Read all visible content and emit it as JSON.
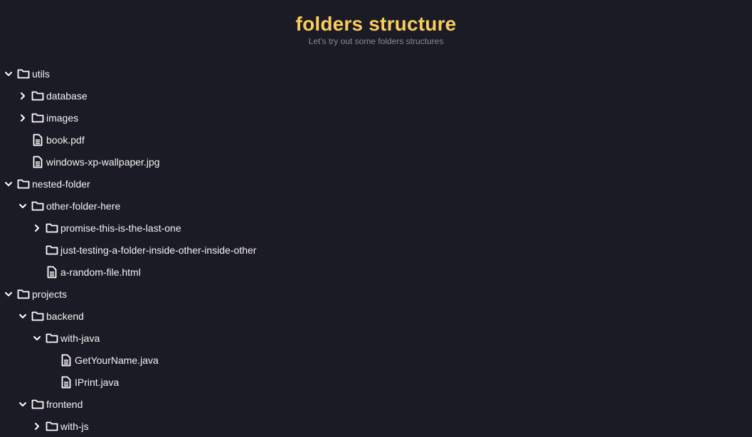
{
  "header": {
    "title": "folders structure",
    "subtitle": "Let's try out some folders structures"
  },
  "tree": [
    {
      "label": "utils",
      "type": "folder",
      "depth": 0,
      "chevron": "down"
    },
    {
      "label": "database",
      "type": "folder",
      "depth": 1,
      "chevron": "right"
    },
    {
      "label": "images",
      "type": "folder",
      "depth": 1,
      "chevron": "right"
    },
    {
      "label": "book.pdf",
      "type": "file",
      "depth": 1,
      "chevron": "none"
    },
    {
      "label": "windows-xp-wallpaper.jpg",
      "type": "file",
      "depth": 1,
      "chevron": "none"
    },
    {
      "label": "nested-folder",
      "type": "folder",
      "depth": 0,
      "chevron": "down"
    },
    {
      "label": "other-folder-here",
      "type": "folder",
      "depth": 1,
      "chevron": "down"
    },
    {
      "label": "promise-this-is-the-last-one",
      "type": "folder",
      "depth": 2,
      "chevron": "right"
    },
    {
      "label": "just-testing-a-folder-inside-other-inside-other",
      "type": "folder",
      "depth": 2,
      "chevron": "none"
    },
    {
      "label": "a-random-file.html",
      "type": "file",
      "depth": 2,
      "chevron": "none"
    },
    {
      "label": "projects",
      "type": "folder",
      "depth": 0,
      "chevron": "down"
    },
    {
      "label": "backend",
      "type": "folder",
      "depth": 1,
      "chevron": "down"
    },
    {
      "label": "with-java",
      "type": "folder",
      "depth": 2,
      "chevron": "down"
    },
    {
      "label": "GetYourName.java",
      "type": "file",
      "depth": 3,
      "chevron": "none"
    },
    {
      "label": "IPrint.java",
      "type": "file",
      "depth": 3,
      "chevron": "none"
    },
    {
      "label": "frontend",
      "type": "folder",
      "depth": 1,
      "chevron": "down"
    },
    {
      "label": "with-js",
      "type": "folder",
      "depth": 2,
      "chevron": "right"
    }
  ]
}
